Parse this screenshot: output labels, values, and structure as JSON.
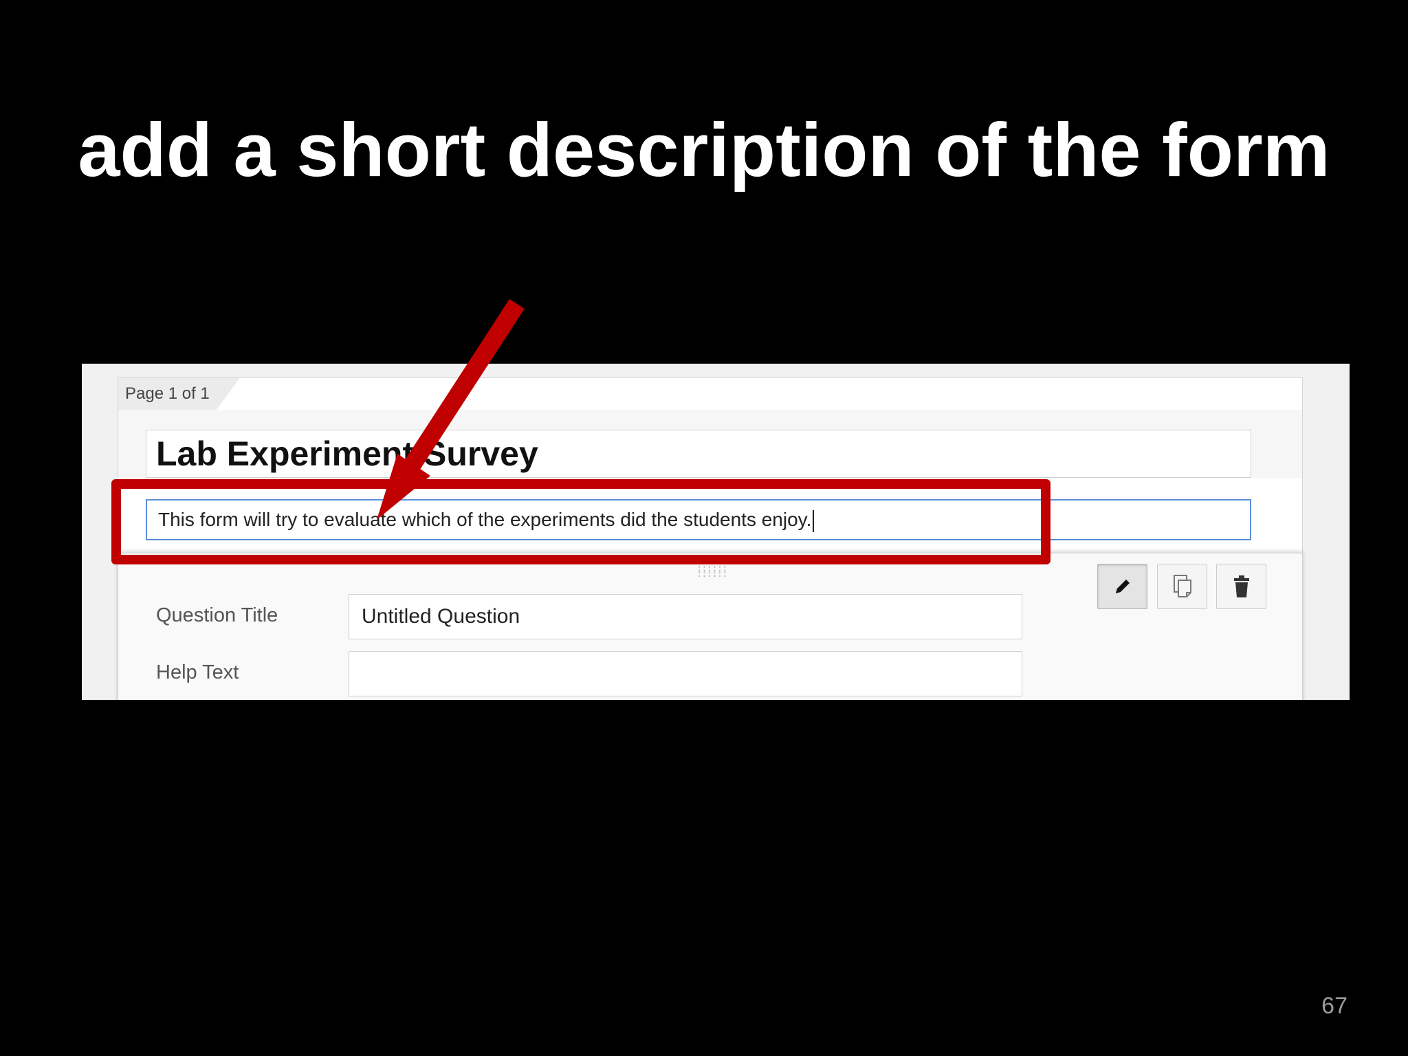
{
  "slide": {
    "title": "add a short description of the form",
    "page_number": "67"
  },
  "form": {
    "page_indicator": "Page 1 of 1",
    "title": "Lab Experiment Survey",
    "description": "This form will try to evaluate which of the experiments did the students enjoy."
  },
  "question": {
    "title_label": "Question Title",
    "title_value": "Untitled Question",
    "help_label": "Help Text",
    "help_value": ""
  },
  "toolbar": {
    "edit_icon": "pencil-icon",
    "copy_icon": "duplicate-icon",
    "delete_icon": "trash-icon"
  },
  "colors": {
    "annotation": "#c00000",
    "focus_border": "#5b8fd9"
  }
}
